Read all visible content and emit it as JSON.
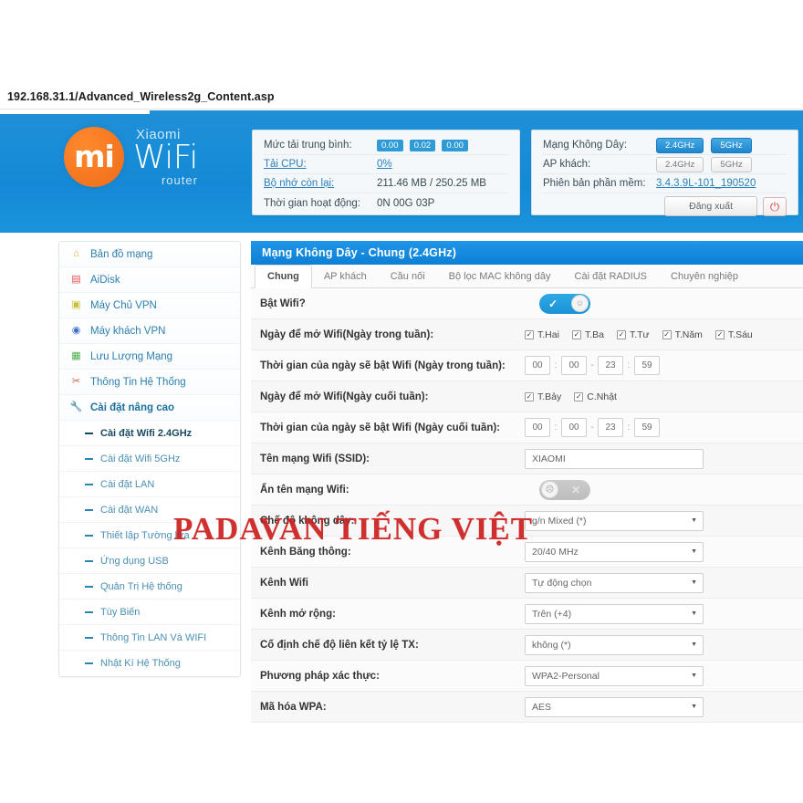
{
  "browser": {
    "url": "192.168.31.1/Advanced_Wireless2g_Content.asp"
  },
  "brand": {
    "mi_glyph": "mi",
    "xiaomi": "Xiaomi",
    "wifi": "WiFi",
    "router": "router",
    "accent_orange": "#f4741f",
    "accent_blue": "#1b8ed8"
  },
  "status_left": {
    "load_label": "Mức tải trung bình:",
    "load_values": [
      "0.00",
      "0.02",
      "0.00"
    ],
    "cpu_label": "Tải CPU:",
    "cpu_value": "0%",
    "mem_label": "Bộ nhớ còn lại:",
    "mem_value": "211.46 MB / 250.25 MB",
    "uptime_label": "Thời gian hoạt động:",
    "uptime_value": "0N 00G 03P"
  },
  "status_right": {
    "wireless_label": "Mạng Không Dây:",
    "wireless_bands": [
      "2.4GHz",
      "5GHz"
    ],
    "guest_label": "AP khách:",
    "guest_bands": [
      "2.4GHz",
      "5GHz"
    ],
    "firmware_label": "Phiên bản phần mềm:",
    "firmware_value": "3.4.3.9L-101_190520",
    "logout_label": "Đăng xuất",
    "power_icon": "power-icon"
  },
  "sidebar": {
    "items": [
      {
        "label": "Bản đồ mạng",
        "icon": "home-icon",
        "color": "#f0a22e"
      },
      {
        "label": "AiDisk",
        "icon": "disk-icon",
        "color": "#e05252"
      },
      {
        "label": "Máy Chủ VPN",
        "icon": "vpn-icon",
        "color": "#e0d24a"
      },
      {
        "label": "Máy khách VPN",
        "icon": "globe-icon",
        "color": "#3f6fd0"
      },
      {
        "label": "Lưu Lượng Mạng",
        "icon": "traffic-icon",
        "color": "#4caf50"
      },
      {
        "label": "Thông Tin Hệ Thống",
        "icon": "tools-icon",
        "color": "#d0563a"
      },
      {
        "label": "Cài đặt nâng cao",
        "icon": "wrench-icon",
        "color": "#b04fa0"
      }
    ],
    "sub_items": [
      {
        "label": "Cài đặt Wifi 2.4GHz",
        "current": true
      },
      {
        "label": "Cài đặt Wifi 5GHz",
        "current": false
      },
      {
        "label": "Cài đặt LAN",
        "current": false
      },
      {
        "label": "Cài đặt WAN",
        "current": false
      },
      {
        "label": "Thiết lập Tường lửa",
        "current": false
      },
      {
        "label": "Ứng dụng USB",
        "current": false
      },
      {
        "label": "Quản Trị Hệ thống",
        "current": false
      },
      {
        "label": "Tùy Biến",
        "current": false
      },
      {
        "label": "Thông Tin LAN Và WIFI",
        "current": false
      },
      {
        "label": "Nhật Kí Hệ Thống",
        "current": false
      }
    ]
  },
  "content": {
    "title": "Mạng Không Dây - Chung (2.4GHz)",
    "tabs": [
      {
        "label": "Chung",
        "active": true
      },
      {
        "label": "AP khách",
        "active": false
      },
      {
        "label": "Cầu nối",
        "active": false
      },
      {
        "label": "Bộ lọc MAC không dây",
        "active": false
      },
      {
        "label": "Cài đặt RADIUS",
        "active": false
      },
      {
        "label": "Chuyên nghiệp",
        "active": false
      }
    ],
    "rows": {
      "enable_wifi_label": "Bật Wifi?",
      "enable_wifi_state": "on",
      "weekday_days_label": "Ngày để mở Wifi(Ngày trong tuần):",
      "weekday_days": [
        "T.Hai",
        "T.Ba",
        "T.Tư",
        "T.Năm",
        "T.Sáu"
      ],
      "weekday_time_label": "Thời gian của ngày sẽ bật Wifi (Ngày trong tuần):",
      "weekday_time": [
        "00",
        "00",
        "23",
        "59"
      ],
      "weekend_days_label": "Ngày để mở Wifi(Ngày cuối tuần):",
      "weekend_days": [
        "T.Bảy",
        "C.Nhật"
      ],
      "weekend_time_label": "Thời gian của ngày sẽ bật Wifi (Ngày cuối tuần):",
      "weekend_time": [
        "00",
        "00",
        "23",
        "59"
      ],
      "ssid_label": "Tên mạng Wifi (SSID):",
      "ssid_value": "XIAOMI",
      "hide_ssid_label": "Ẩn tên mạng Wifi:",
      "hide_ssid_state": "off",
      "wireless_mode_label": "Chế độ không dây:",
      "wireless_mode_value": "g/n Mixed (*)",
      "bandwidth_label": "Kênh Băng thông:",
      "bandwidth_value": "20/40 MHz",
      "channel_label": "Kênh Wifi",
      "channel_value": "Tự động chọn",
      "ext_channel_label": "Kênh mở rộng:",
      "ext_channel_value": "Trên (+4)",
      "tx_rate_label": "Cố định chế độ liên kết tỷ lệ TX:",
      "tx_rate_value": "không (*)",
      "auth_label": "Phương pháp xác thực:",
      "auth_value": "WPA2-Personal",
      "wpa_label": "Mã hóa WPA:",
      "wpa_value": "AES"
    },
    "time_separator": ":",
    "time_dash": "-",
    "check_mark": "✓"
  },
  "watermark": {
    "text": "PADAVAN TIẾNG VIỆT",
    "color": "#cc1f1f"
  }
}
